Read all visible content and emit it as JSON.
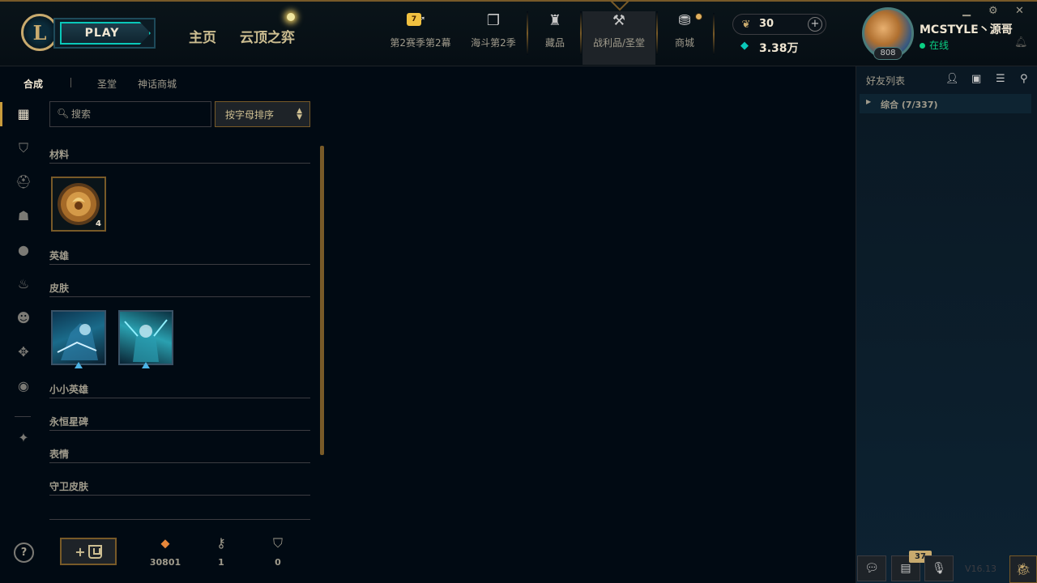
{
  "topbar": {
    "play_label": "PLAY",
    "nav": [
      {
        "label": "主页"
      },
      {
        "label": "云顶之弈"
      }
    ],
    "icons": [
      {
        "label": "第2赛季第2幕",
        "icon": "season-pass-icon",
        "badge": "7"
      },
      {
        "label": "海斗第2季",
        "icon": "cards-icon"
      },
      {
        "label": "藏品",
        "icon": "collection-bag-icon"
      },
      {
        "label": "战利品/圣堂",
        "icon": "loot-pick-icon",
        "active": true
      },
      {
        "label": "商城",
        "icon": "store-coins-icon"
      }
    ],
    "rp": "30",
    "blue_essence": "3.38万",
    "profile": {
      "name": "MCSTYLE丶源哥",
      "status": "在线",
      "level": "808"
    }
  },
  "loot": {
    "subtabs": [
      {
        "label": "合成",
        "active": true
      },
      {
        "label": "圣堂"
      },
      {
        "label": "神话商城"
      }
    ],
    "search_placeholder": "搜索",
    "sort_label": "按字母排序",
    "categories": [
      {
        "label": "材料"
      },
      {
        "label": "英雄"
      },
      {
        "label": "皮肤"
      },
      {
        "label": "小小英雄"
      },
      {
        "label": "永恒星碑"
      },
      {
        "label": "表情"
      },
      {
        "label": "守卫皮肤"
      }
    ],
    "material_qty": "4",
    "resources": [
      {
        "value": "30801",
        "icon": "orange-essence-icon"
      },
      {
        "value": "1",
        "icon": "key-icon"
      },
      {
        "value": "0",
        "icon": "chest-icon"
      }
    ],
    "craft_label": "+"
  },
  "friends": {
    "title": "好友列表",
    "group": "综合 (7/337)",
    "notifications_count": "37",
    "version": "V16.13"
  },
  "colors": {
    "gold": "#c8aa6e",
    "dark_gold": "#785a28",
    "teal": "#0ac8b9",
    "online": "#0acf83",
    "background": "#010a13"
  }
}
